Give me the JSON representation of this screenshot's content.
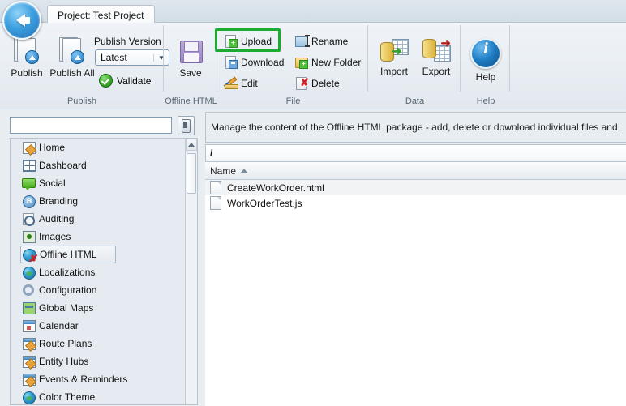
{
  "window": {
    "back_button": "back-arrow",
    "tab_label": "Project: Test Project"
  },
  "ribbon": {
    "groups": [
      {
        "name": "Publish",
        "label": "Publish",
        "big_buttons": [
          {
            "label": "Publish",
            "icon": "document-upload-icon"
          },
          {
            "label": "Publish All",
            "icon": "documents-upload-icon"
          }
        ],
        "publish_version_label": "Publish Version",
        "publish_version_value": "Latest",
        "validate_label": "Validate"
      },
      {
        "name": "Offline HTML",
        "label": "Offline HTML",
        "big_buttons": [
          {
            "label": "Save",
            "icon": "floppy-disk-icon"
          }
        ]
      },
      {
        "name": "File",
        "label": "File",
        "small_buttons": [
          {
            "label": "Upload",
            "icon": "upload-icon",
            "highlighted": true
          },
          {
            "label": "Rename",
            "icon": "rename-icon"
          },
          {
            "label": "Download",
            "icon": "download-icon"
          },
          {
            "label": "New Folder",
            "icon": "new-folder-icon"
          },
          {
            "label": "Edit",
            "icon": "edit-icon"
          },
          {
            "label": "Delete",
            "icon": "delete-icon"
          }
        ]
      },
      {
        "name": "Data",
        "label": "Data",
        "big_buttons": [
          {
            "label": "Import",
            "icon": "database-import-icon"
          },
          {
            "label": "Export",
            "icon": "database-export-icon"
          }
        ]
      },
      {
        "name": "Help",
        "label": "Help",
        "big_buttons": [
          {
            "label": "Help",
            "icon": "info-circle-icon"
          }
        ]
      }
    ]
  },
  "sidebar": {
    "search_value": "",
    "search_placeholder": "",
    "device_button": "device-icon",
    "items": [
      {
        "label": "Home",
        "icon": "home-edit-icon",
        "selected": false
      },
      {
        "label": "Dashboard",
        "icon": "dashboard-grid-icon",
        "selected": false
      },
      {
        "label": "Social",
        "icon": "social-bubble-icon",
        "selected": false
      },
      {
        "label": "Branding",
        "icon": "branding-b-icon",
        "selected": false
      },
      {
        "label": "Auditing",
        "icon": "auditing-icon",
        "selected": false
      },
      {
        "label": "Images",
        "icon": "images-icon",
        "selected": false
      },
      {
        "label": "Offline HTML",
        "icon": "offline-html-icon",
        "selected": true
      },
      {
        "label": "Localizations",
        "icon": "globe-icon",
        "selected": false
      },
      {
        "label": "Configuration",
        "icon": "gear-icon",
        "selected": false
      },
      {
        "label": "Global Maps",
        "icon": "map-icon",
        "selected": false
      },
      {
        "label": "Calendar",
        "icon": "calendar-icon",
        "selected": false
      },
      {
        "label": "Route Plans",
        "icon": "window-edit-icon",
        "selected": false
      },
      {
        "label": "Entity Hubs",
        "icon": "window-edit-icon",
        "selected": false
      },
      {
        "label": "Events & Reminders",
        "icon": "window-edit-icon",
        "selected": false
      },
      {
        "label": "Color Theme",
        "icon": "globe-icon",
        "selected": false
      }
    ],
    "scrollbar": {
      "up_arrow": "scroll-up-icon"
    }
  },
  "main": {
    "description": "Manage the content of the Offline HTML package - add, delete or download individual files and",
    "path": "/",
    "column_header": "Name",
    "sort_direction": "ascending",
    "files": [
      {
        "name": "CreateWorkOrder.html",
        "icon": "file-icon",
        "hover": true
      },
      {
        "name": "WorkOrderTest.js",
        "icon": "file-icon",
        "hover": false
      }
    ]
  },
  "colors": {
    "highlight": "#1aab30",
    "ribbon_bg": "#eaeff4",
    "accent_blue": "#1f7dc4"
  }
}
